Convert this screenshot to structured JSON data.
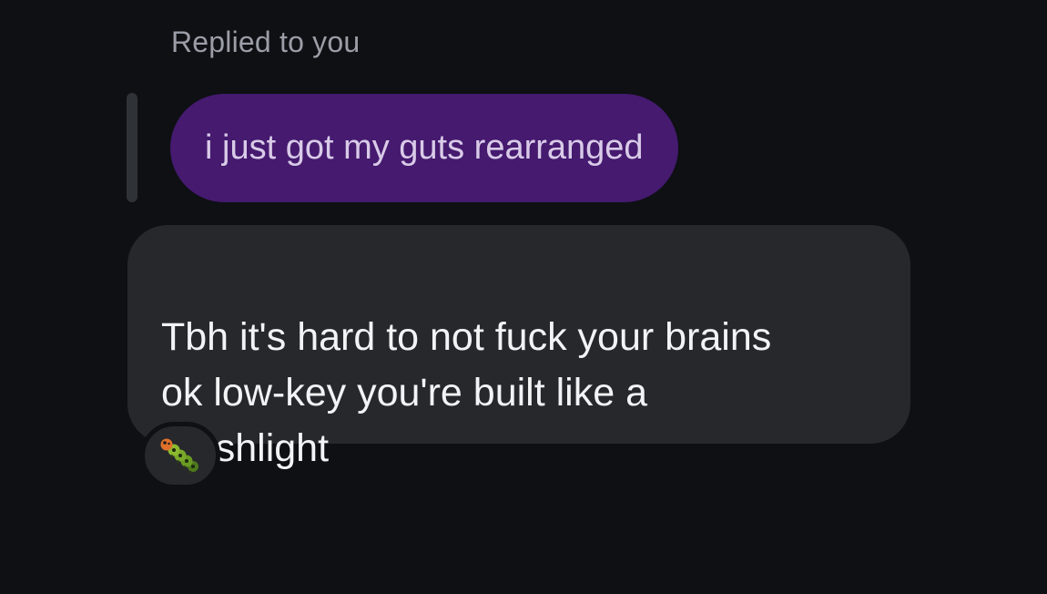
{
  "reply_header": "Replied to you",
  "quoted_message": {
    "text": "i just got my guts rearranged",
    "bubble_color": "#451a6f"
  },
  "message": {
    "text": "Tbh it's hard to not fuck your brains\nok low-key you're built like a\nFleshlight",
    "bubble_color": "#26282c"
  },
  "reaction": {
    "icon": "caterpillar-emoji"
  },
  "colors": {
    "background": "#0e1014",
    "header_text": "#9b9ea6",
    "message_text": "#f2f3f5"
  }
}
